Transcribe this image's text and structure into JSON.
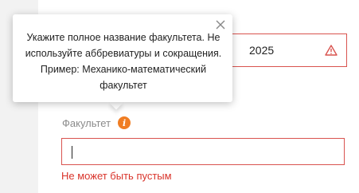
{
  "year_field": {
    "value": "2025",
    "status_icon": "warning-triangle-icon",
    "status_color": "#d9534f"
  },
  "faculty": {
    "label": "Факультет",
    "info_icon": "info-icon",
    "input_value": "",
    "error": "Не может быть пустым"
  },
  "tooltip": {
    "text": "Укажите полное название факультета. Не используйте аббревиатуры и сокращения. Пример: Механико-математический факультет",
    "close_icon": "close-icon"
  },
  "colors": {
    "error": "#d9342b",
    "accent": "#f07d23",
    "border_error": "#d9534f"
  }
}
